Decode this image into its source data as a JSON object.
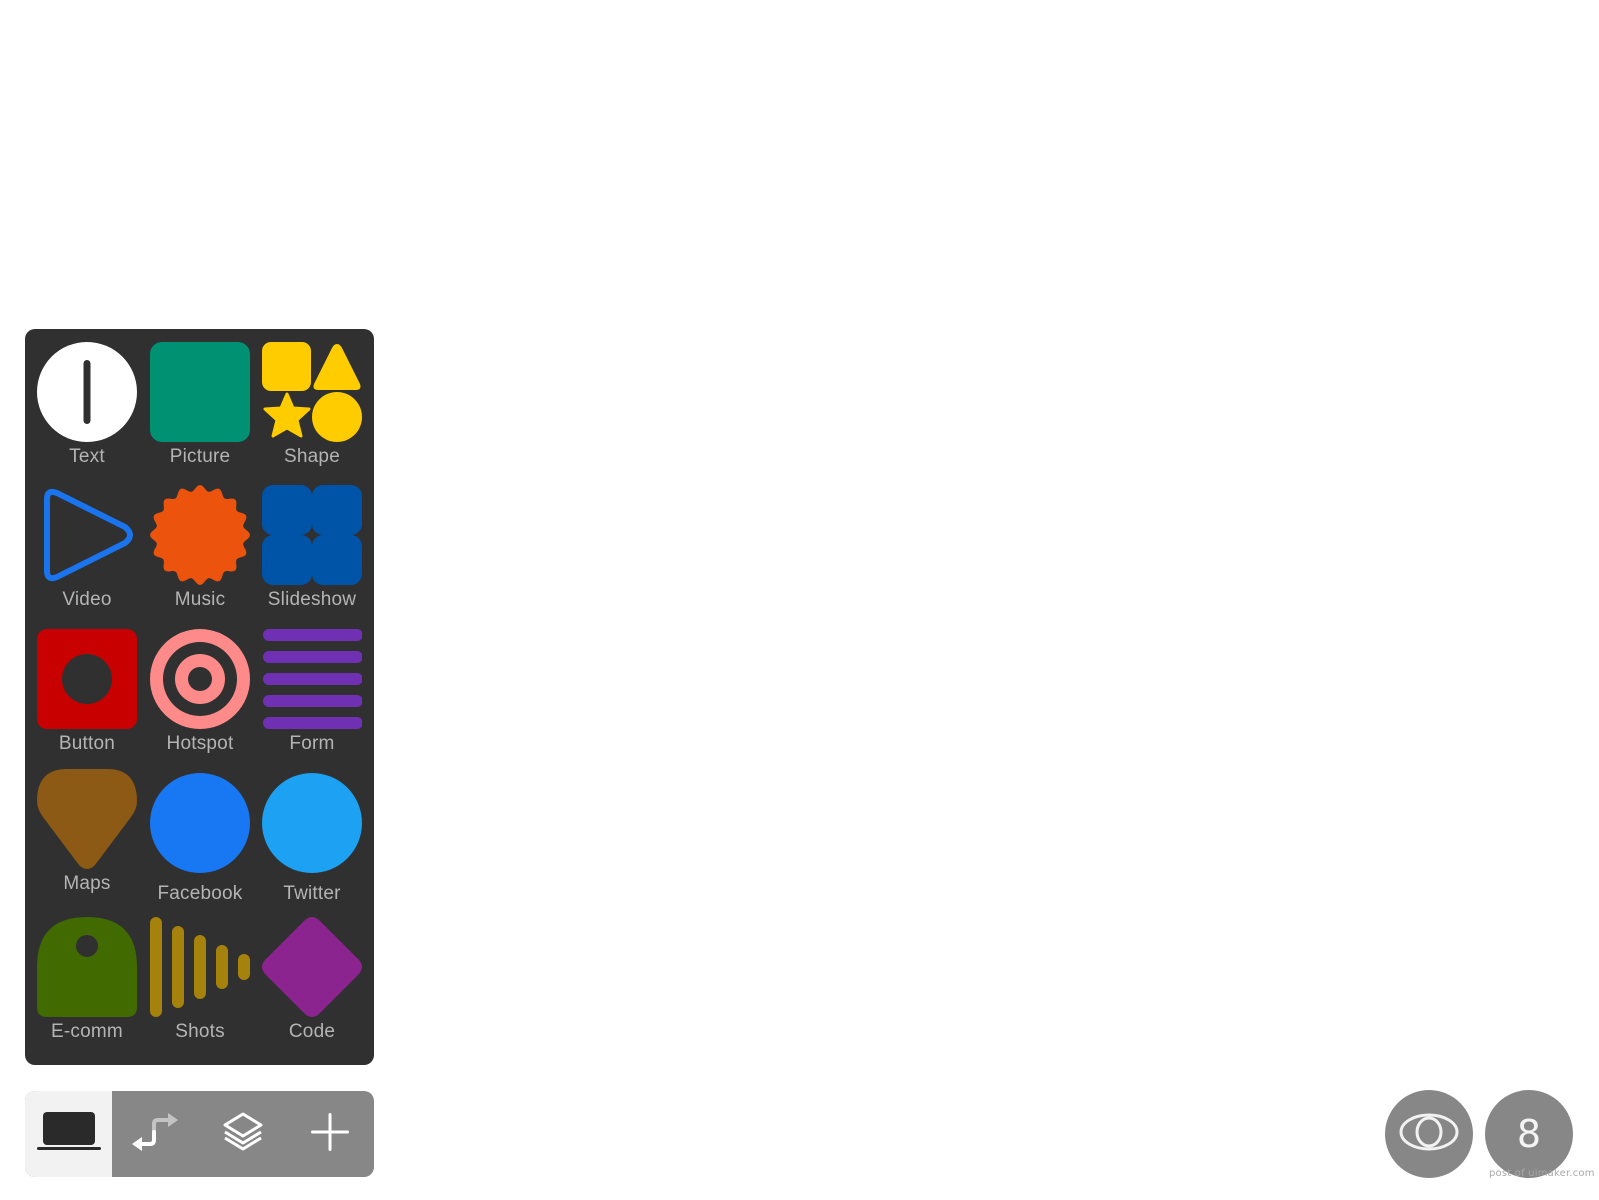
{
  "insert_panel": {
    "items": [
      {
        "label": "Text",
        "icon": "text-cursor-icon",
        "color": "#ffffff"
      },
      {
        "label": "Picture",
        "icon": "picture-icon",
        "color": "#009172"
      },
      {
        "label": "Shape",
        "icon": "shapes-icon",
        "color": "#ffcc00"
      },
      {
        "label": "Video",
        "icon": "play-icon",
        "color": "#1a74ee"
      },
      {
        "label": "Music",
        "icon": "badge-icon",
        "color": "#ec540e"
      },
      {
        "label": "Slideshow",
        "icon": "slideshow-icon",
        "color": "#0054a8"
      },
      {
        "label": "Button",
        "icon": "button-icon",
        "color": "#c80000"
      },
      {
        "label": "Hotspot",
        "icon": "target-icon",
        "color": "#ff8a8a"
      },
      {
        "label": "Form",
        "icon": "form-lines-icon",
        "color": "#7030b4"
      },
      {
        "label": "Maps",
        "icon": "map-pin-icon",
        "color": "#8c5a14"
      },
      {
        "label": "Facebook",
        "icon": "facebook-circle-icon",
        "color": "#1877f2"
      },
      {
        "label": "Twitter",
        "icon": "twitter-circle-icon",
        "color": "#1da1f2"
      },
      {
        "label": "E-comm",
        "icon": "price-tag-icon",
        "color": "#416a00"
      },
      {
        "label": "Shots",
        "icon": "sound-bars-icon",
        "color": "#a5820c"
      },
      {
        "label": "Code",
        "icon": "diamond-icon",
        "color": "#8c2490"
      }
    ]
  },
  "toolbar": {
    "buttons": [
      {
        "name": "device",
        "icon": "laptop-icon",
        "active": true
      },
      {
        "name": "flow",
        "icon": "link-flow-icon",
        "active": false
      },
      {
        "name": "layers",
        "icon": "layers-icon",
        "active": false
      },
      {
        "name": "add",
        "icon": "plus-icon",
        "active": false
      }
    ]
  },
  "preview_button": {
    "icon": "eye-icon"
  },
  "page_count": {
    "value": "8"
  },
  "watermark": "post of uimaker.com"
}
